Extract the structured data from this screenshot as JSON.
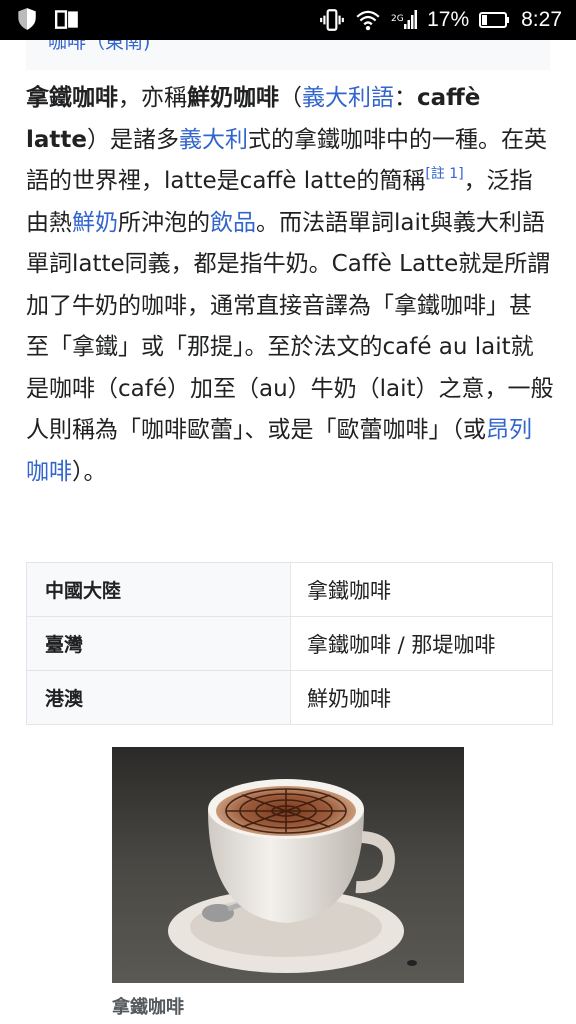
{
  "status_bar": {
    "battery_percent": "17%",
    "time": "8:27",
    "icons": [
      "shield-icon",
      "book-icon",
      "vibrate-icon",
      "wifi-icon",
      "signal-icon",
      "battery-icon"
    ]
  },
  "top_caption_cut": "咖啡（東南)",
  "article": {
    "s1_bold": "拿鐵咖啡",
    "s2": "，亦稱",
    "s3_bold": "鮮奶咖啡",
    "s4": "（",
    "s5_link": "義大利語",
    "s6": "：",
    "s7_bold": "caffè latte",
    "s8": "）是諸多",
    "s9_link": "義大利",
    "s10": "式的拿鐵咖啡中的一種。在英語的世界裡，latte是caffè latte的簡稱",
    "s11_note": "[註 1]",
    "s12": "，泛指由熱",
    "s13_link": "鮮奶",
    "s14": "所沖泡的",
    "s15_link": "飲品",
    "s16": "。而法語單詞lait與義大利語單詞latte同義，都是指牛奶。Caffè Latte就是所謂加了牛奶的咖啡，通常直接音譯為「拿鐵咖啡」甚至「拿鐵」或「那提」。至於法文的café au lait就是咖啡（café）加至（au）牛奶（lait）之意，一般人則稱為「咖啡歐蕾」、或是「歐蕾咖啡」（或",
    "s17_link": "昂列咖啡",
    "s18": "）。"
  },
  "names_table": {
    "rows": [
      {
        "region": "中國大陸",
        "name": "拿鐵咖啡"
      },
      {
        "region": "臺灣",
        "name": "拿鐵咖啡 / 那堤咖啡"
      },
      {
        "region": "港澳",
        "name": "鮮奶咖啡"
      }
    ]
  },
  "figure": {
    "caption": "拿鐵咖啡"
  },
  "colors": {
    "link": "#3366cc",
    "text": "#202122",
    "table_header_bg": "#f8f9fa",
    "table_border": "#e3e5e8",
    "status_bar_bg": "#000000"
  }
}
